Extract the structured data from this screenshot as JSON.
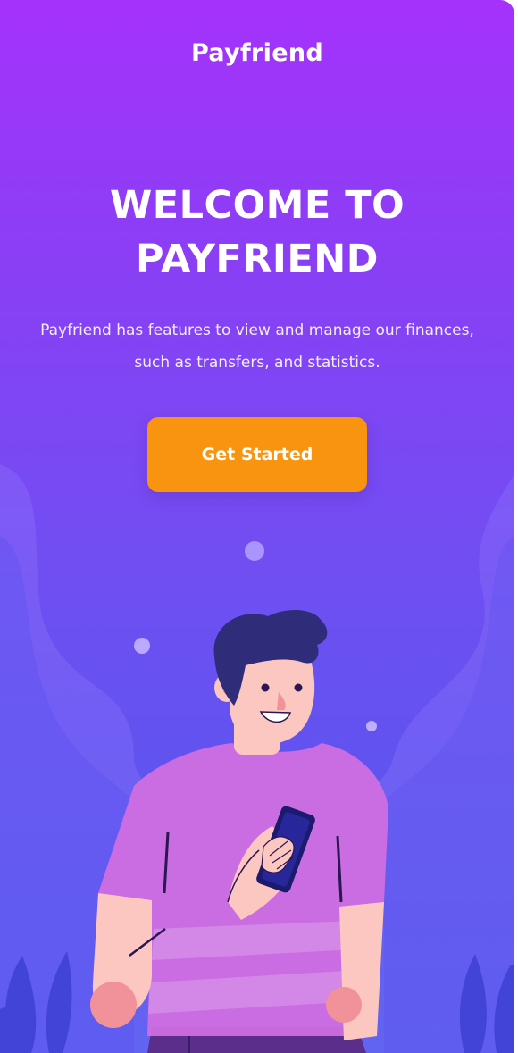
{
  "app": {
    "brand": "Payfriend"
  },
  "welcome": {
    "title_line1": "WELCOME TO",
    "title_line2": "PAYFRIEND",
    "description": "Payfriend has features to view and manage our finances, such as transfers, and statistics."
  },
  "cta": {
    "label": "Get Started"
  },
  "illustration": {
    "subject": "person-holding-phone",
    "icons": [
      "decor-bubble-icon",
      "plant-leaf-icon",
      "smartphone-icon"
    ]
  },
  "colors": {
    "gradient_top": "#a532fb",
    "gradient_bottom": "#4e58ec",
    "button": "#f8940f",
    "shirt": "#d06ee0",
    "skin": "#fbc7c0",
    "hair": "#2f2c7a",
    "phone": "#1c1a6e"
  }
}
